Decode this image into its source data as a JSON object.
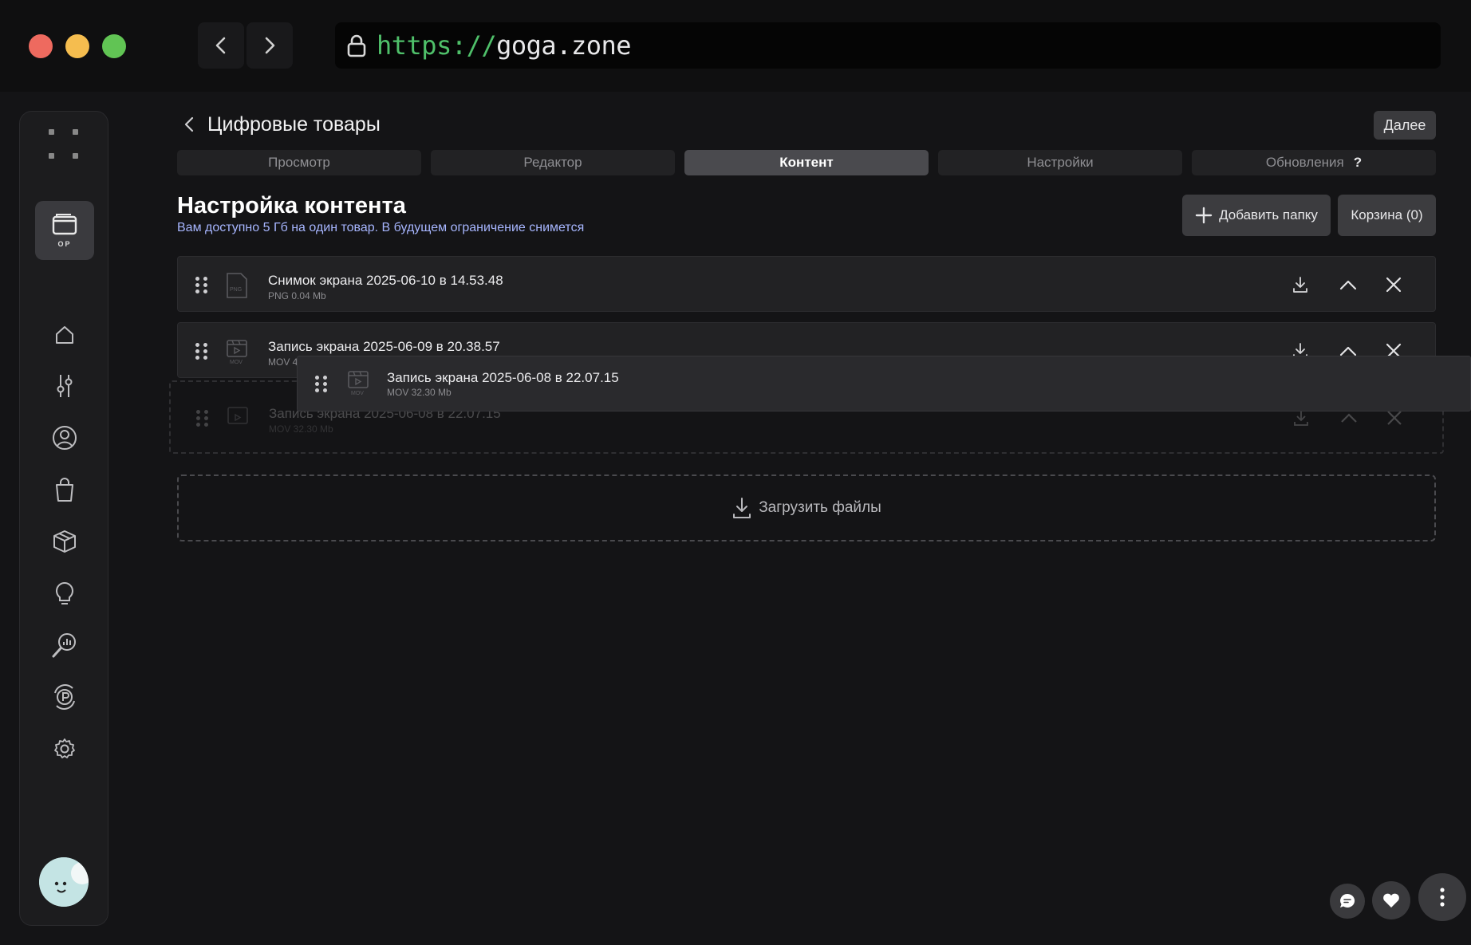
{
  "browser": {
    "url_scheme": "https://",
    "url_host": "goga.zone",
    "icons": [
      "lock-icon",
      "chevron-left-icon",
      "chevron-right-icon"
    ]
  },
  "sidebar": {
    "app_tile_label": "OP",
    "items": [
      {
        "name": "home",
        "icon": "home-icon"
      },
      {
        "name": "filters",
        "icon": "sliders-icon"
      },
      {
        "name": "profile",
        "icon": "user-icon"
      },
      {
        "name": "shop",
        "icon": "bag-icon"
      },
      {
        "name": "products",
        "icon": "box-icon"
      },
      {
        "name": "ideas",
        "icon": "lightbulb-icon"
      },
      {
        "name": "analytics",
        "icon": "search-chart-icon"
      },
      {
        "name": "payments",
        "icon": "coin-icon"
      },
      {
        "name": "settings",
        "icon": "gear-icon"
      }
    ]
  },
  "header": {
    "title": "Цифровые товары",
    "next_label": "Далее"
  },
  "tabs": [
    {
      "label": "Просмотр",
      "active": false
    },
    {
      "label": "Редактор",
      "active": false
    },
    {
      "label": "Контент",
      "active": true
    },
    {
      "label": "Настройки",
      "active": false
    },
    {
      "label": "Обновления",
      "active": false,
      "badge": "?"
    }
  ],
  "content": {
    "title": "Настройка контента",
    "subtitle": "Вам доступно 5 Гб на один товар. В будущем ограничение снимется",
    "add_folder_label": "Добавить папку",
    "trash_label": "Корзина (0)",
    "upload_label": "Загрузить файлы",
    "files": [
      {
        "name": "Снимок экрана 2025-06-10 в 14.53.48",
        "meta": "PNG 0.04 Mb",
        "type": "PNG"
      },
      {
        "name": "Запись экрана 2025-06-09 в 20.38.57",
        "meta": "MOV 40.27 Mb",
        "type": "MOV"
      }
    ],
    "placeholder_file": {
      "name": "Запись экрана 2025-06-08 в 22.07.15",
      "meta": "MOV 32.30 Mb",
      "type": "MOV"
    },
    "dragging_file": {
      "name": "Запись экрана 2025-06-08 в 22.07.15",
      "meta": "MOV 32.30 Mb",
      "type": "MOV"
    }
  },
  "colors": {
    "background": "#141416",
    "accent_link": "#a7b6ff",
    "url_scheme": "#4fc06a"
  }
}
